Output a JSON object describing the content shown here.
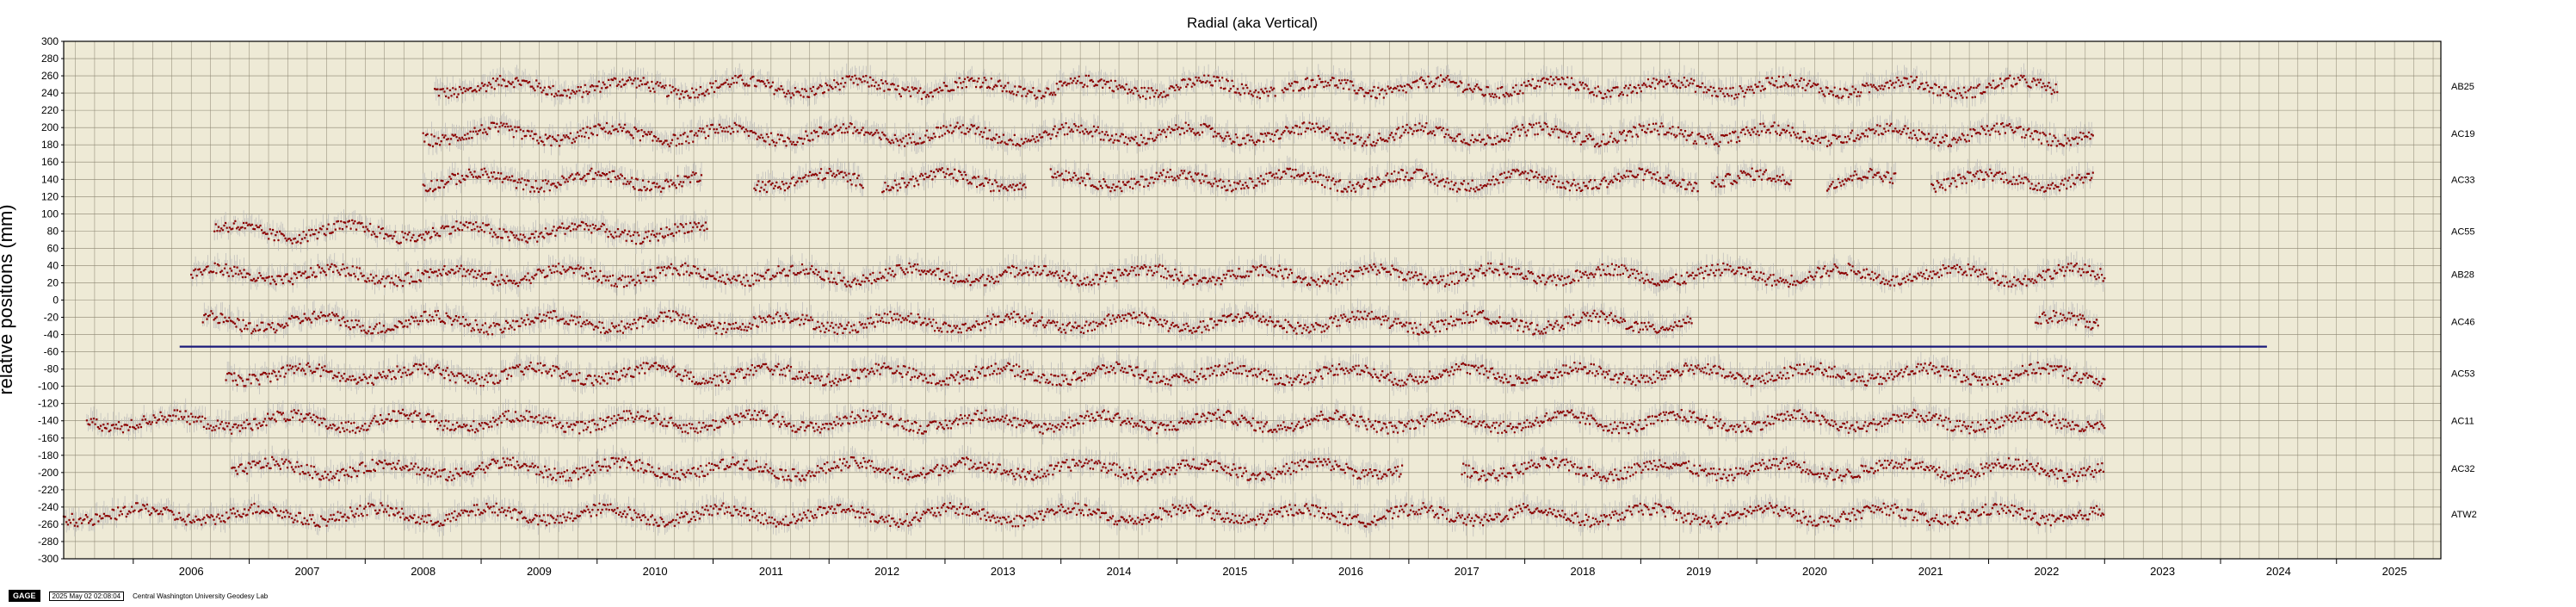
{
  "chart_data": {
    "type": "scatter",
    "title": "Radial (aka Vertical)",
    "xlabel": "",
    "ylabel": "relative positions (mm)",
    "xlim": [
      2005.4,
      2025.9
    ],
    "ylim": [
      -300,
      300
    ],
    "yticks": [
      -300,
      -280,
      -260,
      -240,
      -220,
      -200,
      -180,
      -160,
      -140,
      -120,
      -100,
      -80,
      -60,
      -40,
      -20,
      0,
      20,
      40,
      60,
      80,
      100,
      120,
      140,
      160,
      180,
      200,
      220,
      240,
      260,
      280,
      300
    ],
    "xtick_labels": [
      "2006",
      "2007",
      "2008",
      "2009",
      "2010",
      "2011",
      "2012",
      "2013",
      "2014",
      "2015",
      "2016",
      "2017",
      "2018",
      "2019",
      "2020",
      "2021",
      "2022",
      "2023",
      "2024",
      "2025"
    ],
    "grid": true,
    "reference_line": {
      "y": -54,
      "x_start": 2006.4,
      "x_end": 2024.4,
      "color": "#1a1a7a"
    },
    "colors": {
      "background": "#eeead6",
      "points": "#8b0000",
      "error_bars": "#b8b8b8",
      "grid": "#8a8470"
    },
    "series": [
      {
        "name": "AB25",
        "offset": 248,
        "start": 2008.6,
        "end": 2022.6,
        "gaps": [
          [
            2015.85,
            2015.9
          ]
        ]
      },
      {
        "name": "AC19",
        "offset": 193,
        "start": 2008.5,
        "end": 2022.9,
        "gaps": []
      },
      {
        "name": "AC33",
        "offset": 140,
        "start": 2008.5,
        "end": 2022.9,
        "gaps": [
          [
            2010.9,
            2011.35
          ],
          [
            2012.3,
            2012.45
          ],
          [
            2013.7,
            2013.9
          ],
          [
            2019.5,
            2019.6
          ],
          [
            2020.3,
            2020.6
          ],
          [
            2021.2,
            2021.5
          ]
        ]
      },
      {
        "name": "AC55",
        "offset": 80,
        "start": 2006.7,
        "end": 2010.95,
        "gaps": []
      },
      {
        "name": "AB28",
        "offset": 30,
        "start": 2006.5,
        "end": 2023.0,
        "gaps": []
      },
      {
        "name": "AC46",
        "offset": -25,
        "start": 2006.6,
        "end": 2022.95,
        "gaps": [
          [
            2019.45,
            2022.4
          ]
        ]
      },
      {
        "name": "AC53",
        "offset": -85,
        "start": 2006.8,
        "end": 2023.0,
        "gaps": []
      },
      {
        "name": "AC11",
        "offset": -140,
        "start": 2005.6,
        "end": 2023.0,
        "gaps": []
      },
      {
        "name": "AC32",
        "offset": -195,
        "start": 2006.85,
        "end": 2023.0,
        "gaps": [
          [
            2016.95,
            2017.45
          ]
        ]
      },
      {
        "name": "ATW2",
        "offset": -248,
        "start": 2005.4,
        "end": 2023.0,
        "gaps": []
      }
    ]
  },
  "footer": {
    "logo": "GAGE",
    "timestamp": "2025 May 02 02:08:04",
    "credit": "Central Washington University Geodesy Lab"
  }
}
